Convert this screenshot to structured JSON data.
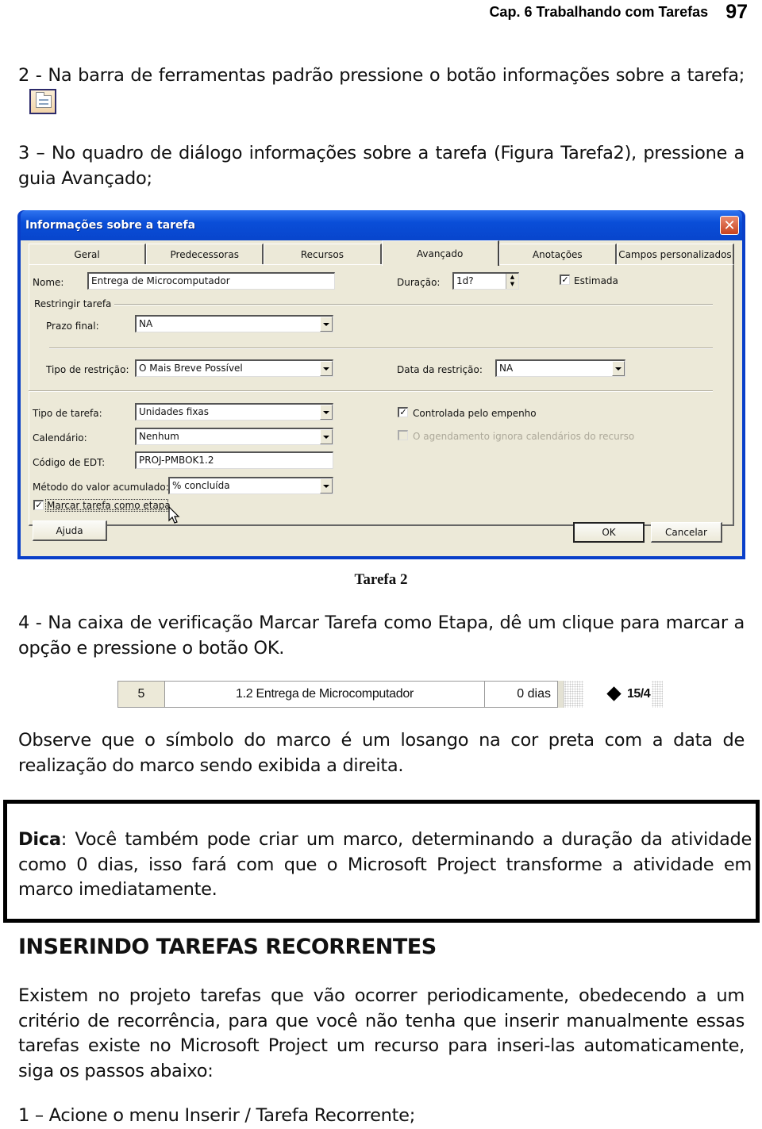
{
  "header": {
    "chapter_title": "Cap. 6 Trabalhando com Tarefas",
    "page_number": "97"
  },
  "step2": {
    "text": "2 - Na barra de ferramentas padrão pressione o botão informações sobre a tarefa;",
    "icon": "task-information-icon"
  },
  "step3": {
    "text": "3 – No quadro de diálogo informações sobre  a tarefa (Figura Tarefa2), pressione a guia Avançado;"
  },
  "dialog": {
    "title": "Informações sobre a tarefa",
    "close_icon": "close-icon",
    "tabs": [
      {
        "label": "Geral",
        "active": false
      },
      {
        "label": "Predecessoras",
        "active": false
      },
      {
        "label": "Recursos",
        "active": false
      },
      {
        "label": "Avançado",
        "active": true
      },
      {
        "label": "Anotações",
        "active": false
      },
      {
        "label": "Campos personalizados",
        "active": false
      }
    ],
    "nome_label": "Nome:",
    "nome_value": "Entrega de Microcomputador",
    "duracao_label": "Duração:",
    "duracao_value": "1d?",
    "estimada_label": "Estimada",
    "estimada_checked": true,
    "restringir_group": "Restringir tarefa",
    "prazo_final_label": "Prazo final:",
    "prazo_final_value": "NA",
    "tipo_restricao_label": "Tipo de restrição:",
    "tipo_restricao_value": "O Mais Breve Possível",
    "data_restricao_label": "Data da restrição:",
    "data_restricao_value": "NA",
    "tipo_tarefa_label": "Tipo de tarefa:",
    "tipo_tarefa_value": "Unidades fixas",
    "controlada_label": "Controlada pelo empenho",
    "controlada_checked": true,
    "calendario_label": "Calendário:",
    "calendario_value": "Nenhum",
    "agendamento_label": "O agendamento ignora calendários do recurso",
    "agendamento_checked": false,
    "edt_label": "Código de EDT:",
    "edt_value": "PROJ-PMBOK1.2",
    "valor_acumulado_label": "Método do valor acumulado:",
    "valor_acumulado_value": "% concluída",
    "marcar_etapa_label": "Marcar tarefa como etapa",
    "marcar_etapa_checked": true,
    "help_button": "Ajuda",
    "ok_button": "OK",
    "cancel_button": "Cancelar"
  },
  "figure_caption": "Tarefa 2",
  "step4": {
    "text": "4 - Na caixa de verificação Marcar Tarefa como Etapa,  dê um clique para marcar a opção e pressione o botão OK."
  },
  "gantt_row": {
    "id": "5",
    "name": "1.2 Entrega de Microcomputador",
    "duration": "0 dias",
    "milestone_icon": "milestone-diamond-icon",
    "milestone_date": "15/4"
  },
  "observation": {
    "text": "Observe que o símbolo do marco é um losango na cor  preta com  a data de realização do marco sendo exibida a direita."
  },
  "tip": {
    "label": "Dica",
    "text": ": Você também pode criar um marco, determinando a duração da atividade como 0 dias, isso fará com que o Microsoft Project transforme a atividade em marco imediatamente."
  },
  "section": {
    "heading": "INSERINDO TAREFAS RECORRENTES",
    "paragraph": "Existem no projeto tarefas que vão ocorrer periodicamente, obedecendo a um critério de recorrência, para que você não tenha que inserir manualmente essas tarefas existe no Microsoft Project um recurso para inseri-las automaticamente, siga os passos abaixo:",
    "step1": "1 – Acione o menu Inserir  / Tarefa Recorrente;"
  }
}
